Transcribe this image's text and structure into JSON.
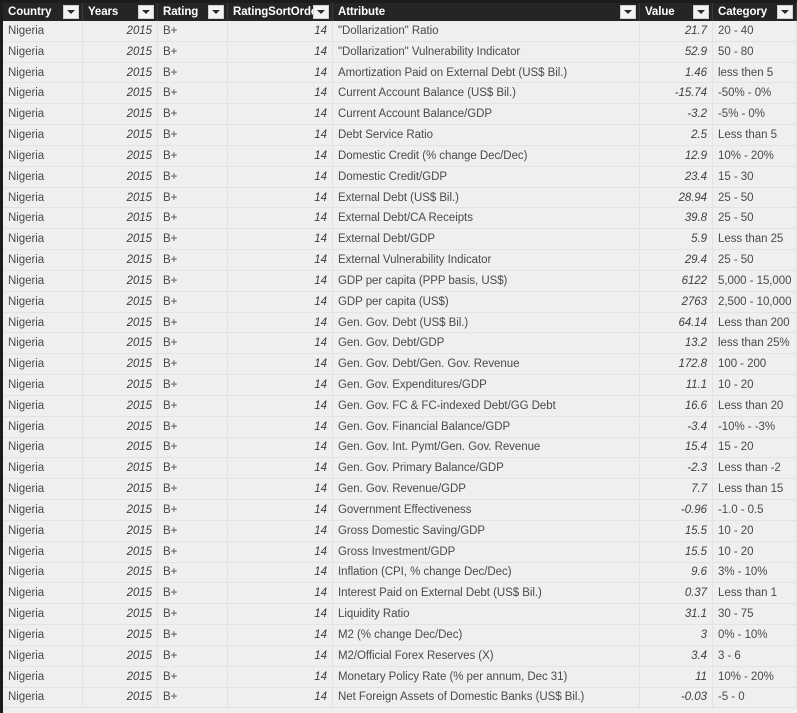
{
  "table": {
    "columns": [
      {
        "key": "country",
        "label": "Country",
        "class": "c-country",
        "align": "left"
      },
      {
        "key": "years",
        "label": "Years",
        "class": "c-years",
        "align": "right"
      },
      {
        "key": "rating",
        "label": "Rating",
        "class": "c-rating",
        "align": "left"
      },
      {
        "key": "sort",
        "label": "RatingSortOrder",
        "class": "c-sort",
        "align": "right"
      },
      {
        "key": "attr",
        "label": "Attribute",
        "class": "c-attr",
        "align": "left"
      },
      {
        "key": "value",
        "label": "Value",
        "class": "c-value",
        "align": "right"
      },
      {
        "key": "category",
        "label": "Category",
        "class": "c-category",
        "align": "left"
      }
    ],
    "filter_icon": "chevron-down-icon",
    "rows": [
      {
        "country": "Nigeria",
        "years": "2015",
        "rating": "B+",
        "sort": "14",
        "attr": "\"Dollarization\" Ratio",
        "value": "21.7",
        "category": "20 - 40"
      },
      {
        "country": "Nigeria",
        "years": "2015",
        "rating": "B+",
        "sort": "14",
        "attr": "\"Dollarization\" Vulnerability Indicator",
        "value": "52.9",
        "category": "50 - 80"
      },
      {
        "country": "Nigeria",
        "years": "2015",
        "rating": "B+",
        "sort": "14",
        "attr": "Amortization Paid on External Debt (US$ Bil.)",
        "value": "1.46",
        "category": "less then 5"
      },
      {
        "country": "Nigeria",
        "years": "2015",
        "rating": "B+",
        "sort": "14",
        "attr": "Current Account Balance (US$ Bil.)",
        "value": "-15.74",
        "category": "-50% - 0%"
      },
      {
        "country": "Nigeria",
        "years": "2015",
        "rating": "B+",
        "sort": "14",
        "attr": "Current Account Balance/GDP",
        "value": "-3.2",
        "category": "-5% - 0%"
      },
      {
        "country": "Nigeria",
        "years": "2015",
        "rating": "B+",
        "sort": "14",
        "attr": "Debt Service Ratio",
        "value": "2.5",
        "category": "Less than 5"
      },
      {
        "country": "Nigeria",
        "years": "2015",
        "rating": "B+",
        "sort": "14",
        "attr": "Domestic Credit (% change Dec/Dec)",
        "value": "12.9",
        "category": "10% - 20%"
      },
      {
        "country": "Nigeria",
        "years": "2015",
        "rating": "B+",
        "sort": "14",
        "attr": "Domestic Credit/GDP",
        "value": "23.4",
        "category": "15 - 30"
      },
      {
        "country": "Nigeria",
        "years": "2015",
        "rating": "B+",
        "sort": "14",
        "attr": "External Debt (US$ Bil.)",
        "value": "28.94",
        "category": "25 - 50"
      },
      {
        "country": "Nigeria",
        "years": "2015",
        "rating": "B+",
        "sort": "14",
        "attr": "External Debt/CA Receipts",
        "value": "39.8",
        "category": "25 - 50"
      },
      {
        "country": "Nigeria",
        "years": "2015",
        "rating": "B+",
        "sort": "14",
        "attr": "External Debt/GDP",
        "value": "5.9",
        "category": "Less than 25"
      },
      {
        "country": "Nigeria",
        "years": "2015",
        "rating": "B+",
        "sort": "14",
        "attr": "External Vulnerability Indicator",
        "value": "29.4",
        "category": "25 - 50"
      },
      {
        "country": "Nigeria",
        "years": "2015",
        "rating": "B+",
        "sort": "14",
        "attr": "GDP per capita (PPP basis, US$)",
        "value": "6122",
        "category": "5,000 - 15,000"
      },
      {
        "country": "Nigeria",
        "years": "2015",
        "rating": "B+",
        "sort": "14",
        "attr": "GDP per capita (US$)",
        "value": "2763",
        "category": "2,500 - 10,000"
      },
      {
        "country": "Nigeria",
        "years": "2015",
        "rating": "B+",
        "sort": "14",
        "attr": "Gen. Gov. Debt (US$ Bil.)",
        "value": "64.14",
        "category": "Less than 200"
      },
      {
        "country": "Nigeria",
        "years": "2015",
        "rating": "B+",
        "sort": "14",
        "attr": "Gen. Gov. Debt/GDP",
        "value": "13.2",
        "category": "less than 25%"
      },
      {
        "country": "Nigeria",
        "years": "2015",
        "rating": "B+",
        "sort": "14",
        "attr": "Gen. Gov. Debt/Gen. Gov. Revenue",
        "value": "172.8",
        "category": "100 - 200"
      },
      {
        "country": "Nigeria",
        "years": "2015",
        "rating": "B+",
        "sort": "14",
        "attr": "Gen. Gov. Expenditures/GDP",
        "value": "11.1",
        "category": "10 - 20"
      },
      {
        "country": "Nigeria",
        "years": "2015",
        "rating": "B+",
        "sort": "14",
        "attr": "Gen. Gov. FC & FC-indexed Debt/GG Debt",
        "value": "16.6",
        "category": "Less than 20"
      },
      {
        "country": "Nigeria",
        "years": "2015",
        "rating": "B+",
        "sort": "14",
        "attr": "Gen. Gov. Financial Balance/GDP",
        "value": "-3.4",
        "category": "-10% - -3%"
      },
      {
        "country": "Nigeria",
        "years": "2015",
        "rating": "B+",
        "sort": "14",
        "attr": "Gen. Gov. Int. Pymt/Gen. Gov. Revenue",
        "value": "15.4",
        "category": "15 - 20"
      },
      {
        "country": "Nigeria",
        "years": "2015",
        "rating": "B+",
        "sort": "14",
        "attr": "Gen. Gov. Primary Balance/GDP",
        "value": "-2.3",
        "category": "Less than -2"
      },
      {
        "country": "Nigeria",
        "years": "2015",
        "rating": "B+",
        "sort": "14",
        "attr": "Gen. Gov. Revenue/GDP",
        "value": "7.7",
        "category": "Less than 15"
      },
      {
        "country": "Nigeria",
        "years": "2015",
        "rating": "B+",
        "sort": "14",
        "attr": "Government Effectiveness",
        "value": "-0.96",
        "category": "-1.0 - 0.5"
      },
      {
        "country": "Nigeria",
        "years": "2015",
        "rating": "B+",
        "sort": "14",
        "attr": "Gross Domestic Saving/GDP",
        "value": "15.5",
        "category": "10 - 20"
      },
      {
        "country": "Nigeria",
        "years": "2015",
        "rating": "B+",
        "sort": "14",
        "attr": "Gross Investment/GDP",
        "value": "15.5",
        "category": "10 - 20"
      },
      {
        "country": "Nigeria",
        "years": "2015",
        "rating": "B+",
        "sort": "14",
        "attr": "Inflation (CPI, % change Dec/Dec)",
        "value": "9.6",
        "category": "3% - 10%"
      },
      {
        "country": "Nigeria",
        "years": "2015",
        "rating": "B+",
        "sort": "14",
        "attr": "Interest Paid on External Debt (US$ Bil.)",
        "value": "0.37",
        "category": "Less than 1"
      },
      {
        "country": "Nigeria",
        "years": "2015",
        "rating": "B+",
        "sort": "14",
        "attr": "Liquidity Ratio",
        "value": "31.1",
        "category": "30 - 75"
      },
      {
        "country": "Nigeria",
        "years": "2015",
        "rating": "B+",
        "sort": "14",
        "attr": "M2 (% change Dec/Dec)",
        "value": "3",
        "category": "0% - 10%"
      },
      {
        "country": "Nigeria",
        "years": "2015",
        "rating": "B+",
        "sort": "14",
        "attr": "M2/Official Forex Reserves (X)",
        "value": "3.4",
        "category": "3 - 6"
      },
      {
        "country": "Nigeria",
        "years": "2015",
        "rating": "B+",
        "sort": "14",
        "attr": "Monetary Policy Rate (% per annum, Dec 31)",
        "value": "11",
        "category": "10% - 20%"
      },
      {
        "country": "Nigeria",
        "years": "2015",
        "rating": "B+",
        "sort": "14",
        "attr": "Net Foreign Assets of Domestic Banks (US$ Bil.)",
        "value": "-0.03",
        "category": "-5 - 0"
      }
    ]
  },
  "colors": {
    "header_bg": "#252525",
    "frame": "#1c1c1c",
    "row_bg": "#efefef",
    "row_line": "#e3e3e3",
    "text": "#4a4a4a",
    "header_text": "#ffffff"
  }
}
